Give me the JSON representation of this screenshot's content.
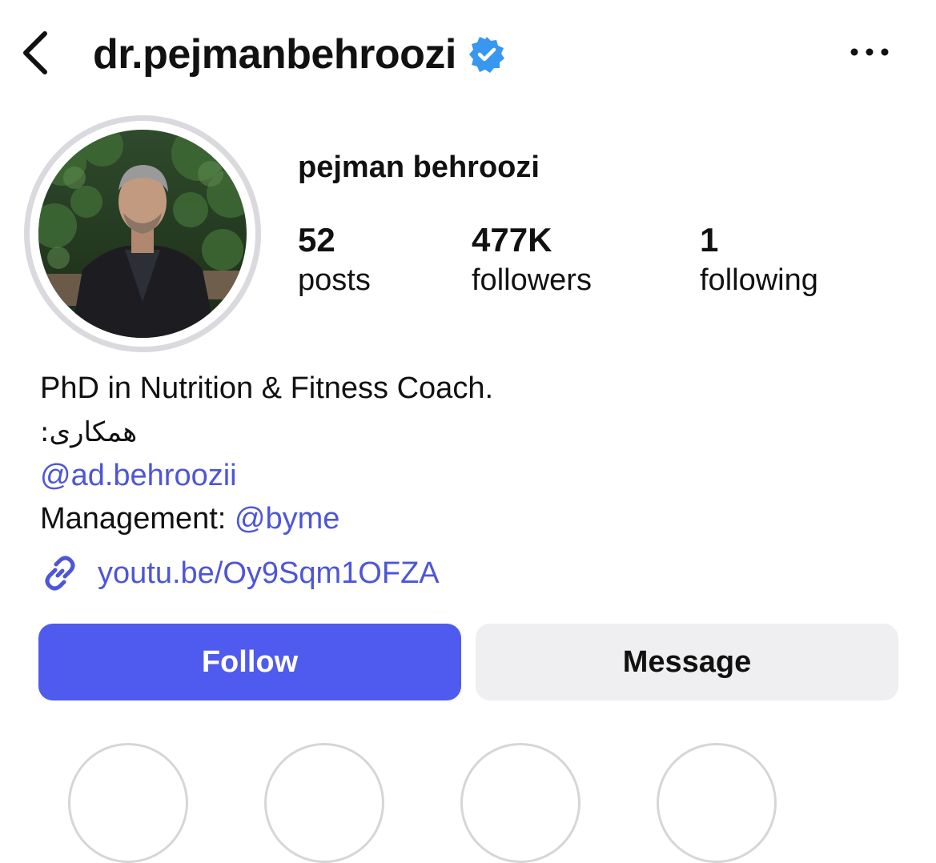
{
  "header": {
    "back_icon": "chevron-left-icon",
    "username": "dr.pejmanbehroozi",
    "verified_icon": "verified-badge-icon",
    "more_icon": "more-horizontal-icon"
  },
  "profile": {
    "display_name": "pejman behroozi",
    "stats": [
      {
        "value": "52",
        "label": "posts"
      },
      {
        "value": "477K",
        "label": "followers"
      },
      {
        "value": "1",
        "label": "following"
      }
    ]
  },
  "bio": {
    "line1": "PhD in Nutrition & Fitness Coach.",
    "line2": "همکاری:",
    "mention1": "@ad.behroozii",
    "management_label": "Management: ",
    "mention2": "@byme",
    "link_icon": "link-icon",
    "link": "youtu.be/Oy9Sqm1OFZA"
  },
  "actions": {
    "follow": "Follow",
    "message": "Message"
  },
  "colors": {
    "accent": "#4f5aee",
    "link": "#4d56d9",
    "verified": "#3897f0",
    "secondary_button": "#efeff2"
  }
}
